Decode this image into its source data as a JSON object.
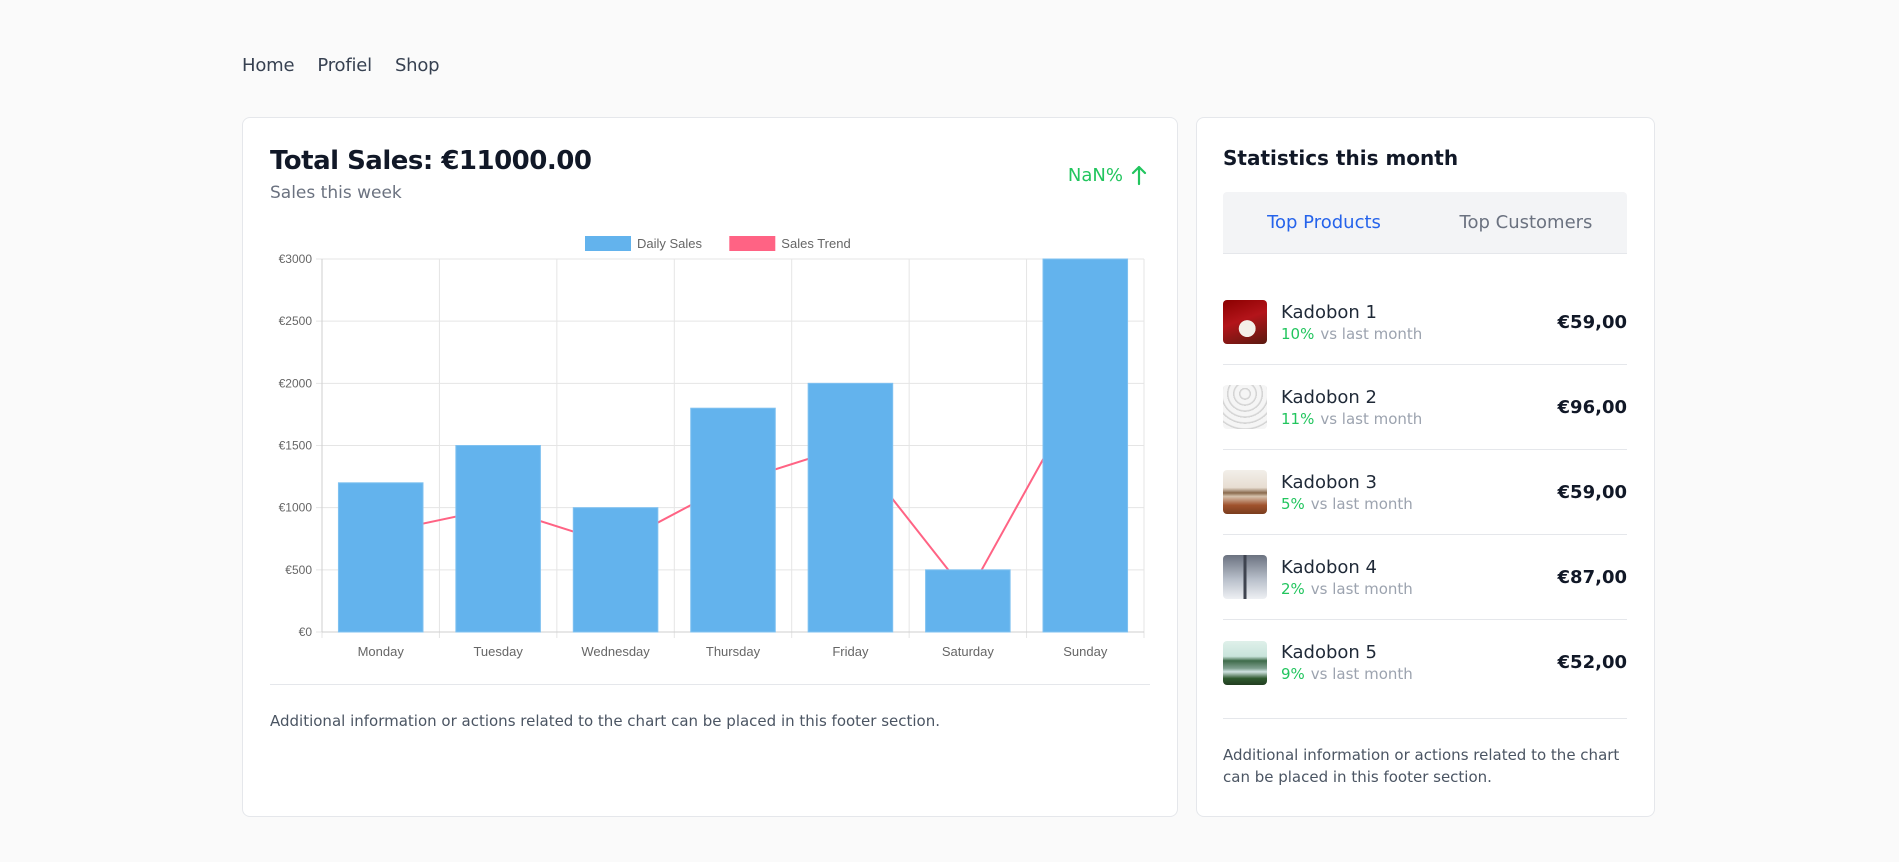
{
  "nav": {
    "items": [
      {
        "label": "Home"
      },
      {
        "label": "Profiel"
      },
      {
        "label": "Shop"
      }
    ]
  },
  "sales_card": {
    "title": "Total Sales: €11000.00",
    "subtitle": "Sales this week",
    "growth_label": "NaN%",
    "growth_icon": "arrow-up-icon",
    "growth_color": "#22c55e",
    "footer": "Additional information or actions related to the chart can be placed in this footer section."
  },
  "chart_data": {
    "type": "bar",
    "title": "",
    "xlabel": "",
    "ylabel": "",
    "categories": [
      "Monday",
      "Tuesday",
      "Wednesday",
      "Thursday",
      "Friday",
      "Saturday",
      "Sunday"
    ],
    "series": [
      {
        "name": "Daily Sales",
        "type": "bar",
        "color": "#63b3ed",
        "values": [
          1200,
          1500,
          1000,
          1800,
          2000,
          500,
          3000
        ]
      },
      {
        "name": "Sales Trend",
        "type": "line",
        "color": "#ff6384",
        "values": [
          800,
          1000,
          700,
          1200,
          1500,
          300,
          2000
        ]
      }
    ],
    "ylim": [
      0,
      3000
    ],
    "yticks": [
      0,
      500,
      1000,
      1500,
      2000,
      2500,
      3000
    ],
    "ytick_prefix": "€",
    "grid": true,
    "legend": "top-center"
  },
  "stats_card": {
    "title": "Statistics this month",
    "tabs": [
      {
        "label": "Top Products",
        "active": true
      },
      {
        "label": "Top Customers",
        "active": false
      }
    ],
    "products": [
      {
        "name": "Kadobon 1",
        "change": "10%",
        "compare": "vs last month",
        "price": "€59,00",
        "thumb": "red-shoes"
      },
      {
        "name": "Kadobon 2",
        "change": "11%",
        "compare": "vs last month",
        "price": "€96,00",
        "thumb": "white-dome"
      },
      {
        "name": "Kadobon 3",
        "change": "5%",
        "compare": "vs last month",
        "price": "€59,00",
        "thumb": "desert-landscape"
      },
      {
        "name": "Kadobon 4",
        "change": "2%",
        "compare": "vs last month",
        "price": "€87,00",
        "thumb": "grey-tower"
      },
      {
        "name": "Kadobon 5",
        "change": "9%",
        "compare": "vs last month",
        "price": "€52,00",
        "thumb": "green-lake"
      }
    ],
    "footer": "Additional information or actions related to the chart can be placed in this footer section."
  }
}
